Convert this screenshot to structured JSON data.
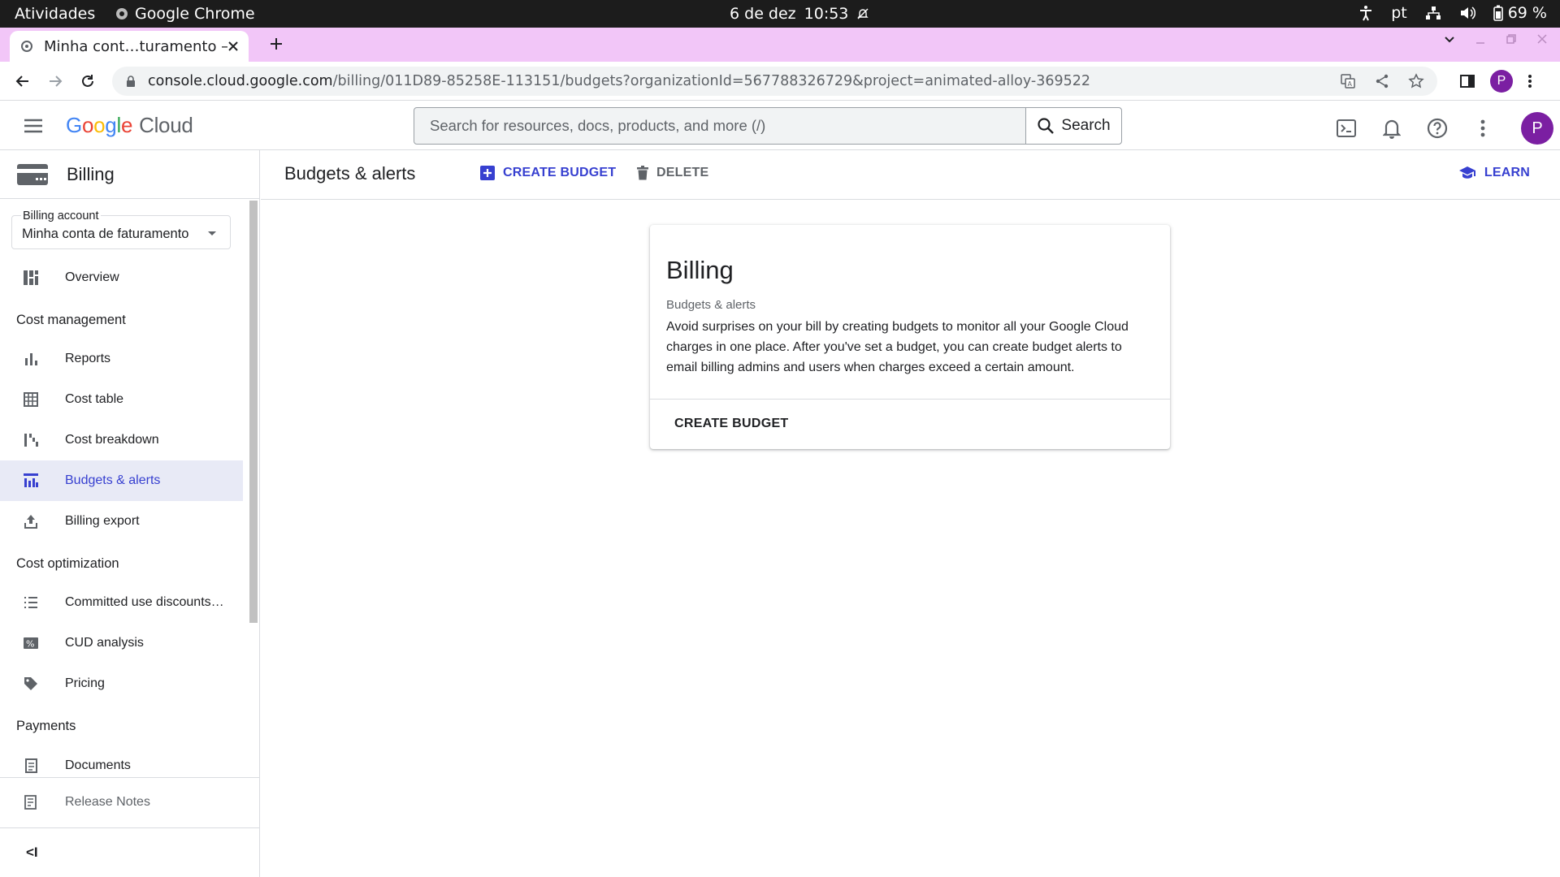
{
  "os": {
    "activities": "Atividades",
    "app_name": "Google Chrome",
    "date": "6 de dez",
    "time": "10:53",
    "language": "pt",
    "battery": "69 %"
  },
  "browser": {
    "tab_title": "Minha cont…turamento –",
    "url_host": "console.cloud.google.com",
    "url_path": "/billing/011D89-85258E-113151/budgets?organizationId=567788326729&project=animated-alloy-369522",
    "profile_initial": "P"
  },
  "header": {
    "logo_cloud": "Cloud",
    "search_placeholder": "Search for resources, docs, products, and more (/)",
    "search_button": "Search",
    "avatar_initial": "P"
  },
  "sidebar": {
    "title": "Billing",
    "account_label": "Billing account",
    "account_value": "Minha conta de faturamento",
    "overview": "Overview",
    "section_cost_management": "Cost management",
    "reports": "Reports",
    "cost_table": "Cost table",
    "cost_breakdown": "Cost breakdown",
    "budgets_alerts": "Budgets & alerts",
    "billing_export": "Billing export",
    "section_cost_optimization": "Cost optimization",
    "committed_use": "Committed use discounts…",
    "cud_analysis": "CUD analysis",
    "pricing": "Pricing",
    "section_payments": "Payments",
    "documents": "Documents",
    "release_notes": "Release Notes",
    "collapse": "<I"
  },
  "page": {
    "title": "Budgets & alerts",
    "create_budget": "CREATE BUDGET",
    "delete": "DELETE",
    "learn": "LEARN"
  },
  "card": {
    "title": "Billing",
    "subtitle": "Budgets & alerts",
    "description": "Avoid surprises on your bill by creating budgets to monitor all your Google Cloud charges in one place. After you've set a budget, you can create budget alerts to email billing admins and users when charges exceed a certain amount.",
    "button": "CREATE BUDGET"
  },
  "colors": {
    "accent": "#3740d0",
    "tabstrip": "#f2c6f8",
    "avatar": "#7b1fa2",
    "active_nav_bg": "#e8eaf6"
  }
}
